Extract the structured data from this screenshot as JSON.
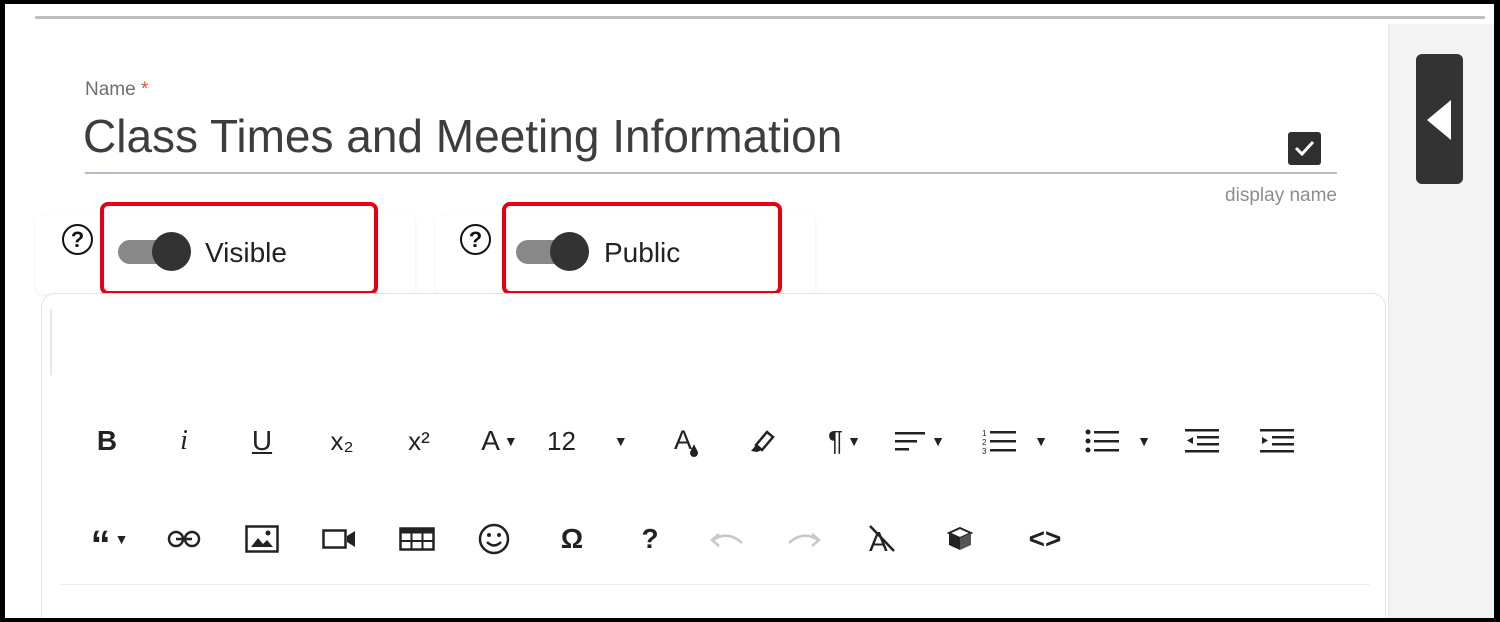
{
  "form": {
    "name_label": "Name",
    "required_mark": "*",
    "name_value": "Class Times and Meeting Information",
    "name_hint": "display name"
  },
  "toggles": [
    {
      "label": "Visible",
      "on": true,
      "help": "?"
    },
    {
      "label": "Public",
      "on": true,
      "help": "?"
    }
  ],
  "toolbar": {
    "row1": [
      {
        "icon": "bold-icon",
        "glyph": "B"
      },
      {
        "icon": "italic-icon",
        "glyph": "i"
      },
      {
        "icon": "underline-icon",
        "glyph": "U"
      },
      {
        "icon": "subscript-icon",
        "glyph": "x₂"
      },
      {
        "icon": "superscript-icon",
        "glyph": "x²"
      },
      {
        "icon": "font-family-icon",
        "glyph": "A"
      },
      {
        "icon": "font-size-dropdown",
        "glyph": "12"
      },
      {
        "icon": "text-color-icon",
        "glyph": "A"
      },
      {
        "icon": "highlight-icon",
        "glyph": "highlighter"
      },
      {
        "icon": "paragraph-format-icon",
        "glyph": "¶"
      },
      {
        "icon": "align-icon",
        "glyph": "align"
      },
      {
        "icon": "ordered-list-icon",
        "glyph": "ol"
      },
      {
        "icon": "unordered-list-icon",
        "glyph": "ul"
      },
      {
        "icon": "outdent-icon",
        "glyph": "outdent"
      },
      {
        "icon": "indent-icon",
        "glyph": "indent"
      }
    ],
    "row2": [
      {
        "icon": "quote-icon",
        "glyph": "“"
      },
      {
        "icon": "link-icon",
        "glyph": "link"
      },
      {
        "icon": "image-icon",
        "glyph": "image"
      },
      {
        "icon": "video-icon",
        "glyph": "video"
      },
      {
        "icon": "table-icon",
        "glyph": "table"
      },
      {
        "icon": "emoji-icon",
        "glyph": "☺"
      },
      {
        "icon": "special-characters-icon",
        "glyph": "Ω"
      },
      {
        "icon": "help-icon",
        "glyph": "?"
      },
      {
        "icon": "undo-icon",
        "glyph": "undo",
        "disabled": true
      },
      {
        "icon": "redo-icon",
        "glyph": "redo",
        "disabled": true
      },
      {
        "icon": "clear-formatting-icon",
        "glyph": "clear"
      },
      {
        "icon": "insert-block-icon",
        "glyph": "cube"
      },
      {
        "icon": "code-view-icon",
        "glyph": "<>"
      }
    ]
  },
  "colors": {
    "accent_dark": "#333333",
    "highlight_red": "#e60012",
    "required": "#e2542d"
  }
}
